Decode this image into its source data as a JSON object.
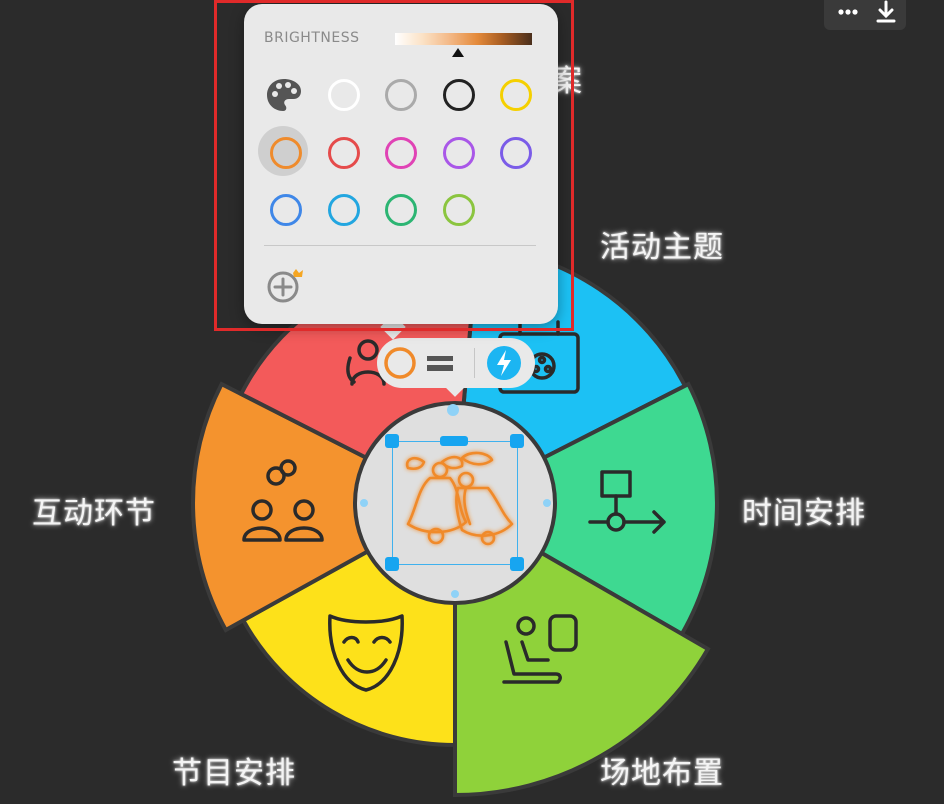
{
  "diagram": {
    "labels": {
      "top_partial": "案",
      "activity_theme": "活动主题",
      "time_schedule": "时间安排",
      "venue_layout": "场地布置",
      "program_schedule": "节目安排",
      "interaction": "互动环节"
    },
    "colors": {
      "cyan": "#1cc1f4",
      "teal": "#3ed991",
      "lime": "#8fd23a",
      "yellow": "#fde11a",
      "orange": "#f4932e",
      "red": "#f35a5a",
      "center_fill": "#dfdfdf",
      "icon_stroke": "#2a2a2a",
      "selected_icon": "#f08a2a"
    },
    "icons": {
      "theme": "film-reel-icon",
      "time": "flowchart-arrow-icon",
      "venue": "seated-person-icon",
      "program": "theater-mask-icon",
      "interaction": "people-rings-icon",
      "team": "team-people-icon",
      "center": "christmas-bells-icon"
    }
  },
  "topbar": {
    "more_icon": "more-dots-icon",
    "download_icon": "download-icon"
  },
  "color_picker": {
    "brightness_label": "BRIGHTNESS",
    "brightness_level": 0.5,
    "selected_swatch": "orange",
    "swatches": [
      [
        "palette",
        "#ffffff",
        "#aaaaaa",
        "#222222",
        "#f5d000"
      ],
      [
        "#ef8b2c",
        "#e54b4b",
        "#e043b5",
        "#a957e8",
        "#7b5ce8"
      ],
      [
        "#3f87e8",
        "#22a6e0",
        "#2cb573",
        "#8bc53f"
      ]
    ],
    "add_icon": "add-color-premium-icon"
  },
  "toolbar": {
    "color_icon": "color-circle-icon",
    "stroke_icon": "stroke-width-icon",
    "ai_icon": "lightning-icon",
    "color_value": "#f08a2a",
    "ai_color": "#1cb5f2"
  }
}
